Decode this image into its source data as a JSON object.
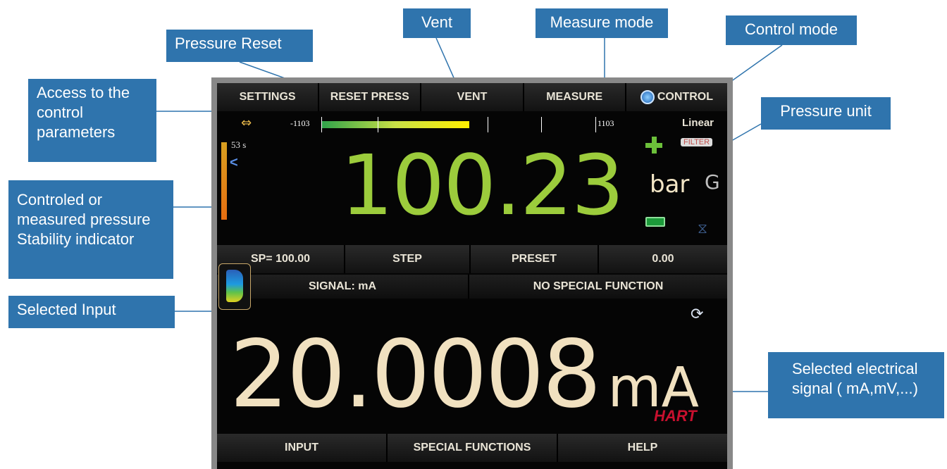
{
  "callouts": {
    "pressure_reset": "Pressure Reset",
    "vent": "Vent",
    "measure_mode": "Measure mode",
    "control_mode": "Control mode",
    "access_control": "Access to the\ncontrol\nparameters",
    "pressure_unit": "Pressure unit",
    "controlled_pressure": "Controled or\nmeasured pressure\nStability indicator",
    "selected_input": "Selected Input",
    "selected_signal": "Selected electrical\nsignal ( mA,mV,...)"
  },
  "top_bar": {
    "settings": "SETTINGS",
    "reset_press": "RESET PRESS",
    "vent": "VENT",
    "measure": "MEASURE",
    "control": "CONTROL"
  },
  "scale": {
    "min": "-1103",
    "max": "1103",
    "mode": "Linear",
    "filter": "FILTER"
  },
  "timer": "53 s",
  "pressure": {
    "value": "100.23",
    "unit": "bar",
    "type": "G"
  },
  "mid_bar": {
    "setpoint": "SP= 100.00",
    "step": "STEP",
    "preset": "PRESET",
    "preset_value": "0.00"
  },
  "function_bar": {
    "signal": "SIGNAL: mA",
    "special": "NO SPECIAL FUNCTION"
  },
  "signal": {
    "value": "20.0008",
    "unit": "mA"
  },
  "hart": "HART",
  "bottom_bar": {
    "input": "INPUT",
    "special_functions": "SPECIAL FUNCTIONS",
    "help": "HELP"
  },
  "colors": {
    "callout": "#2f74ad",
    "pressure": "#9ccc3c",
    "signal": "#f1e1c0",
    "hart": "#c8102e"
  }
}
